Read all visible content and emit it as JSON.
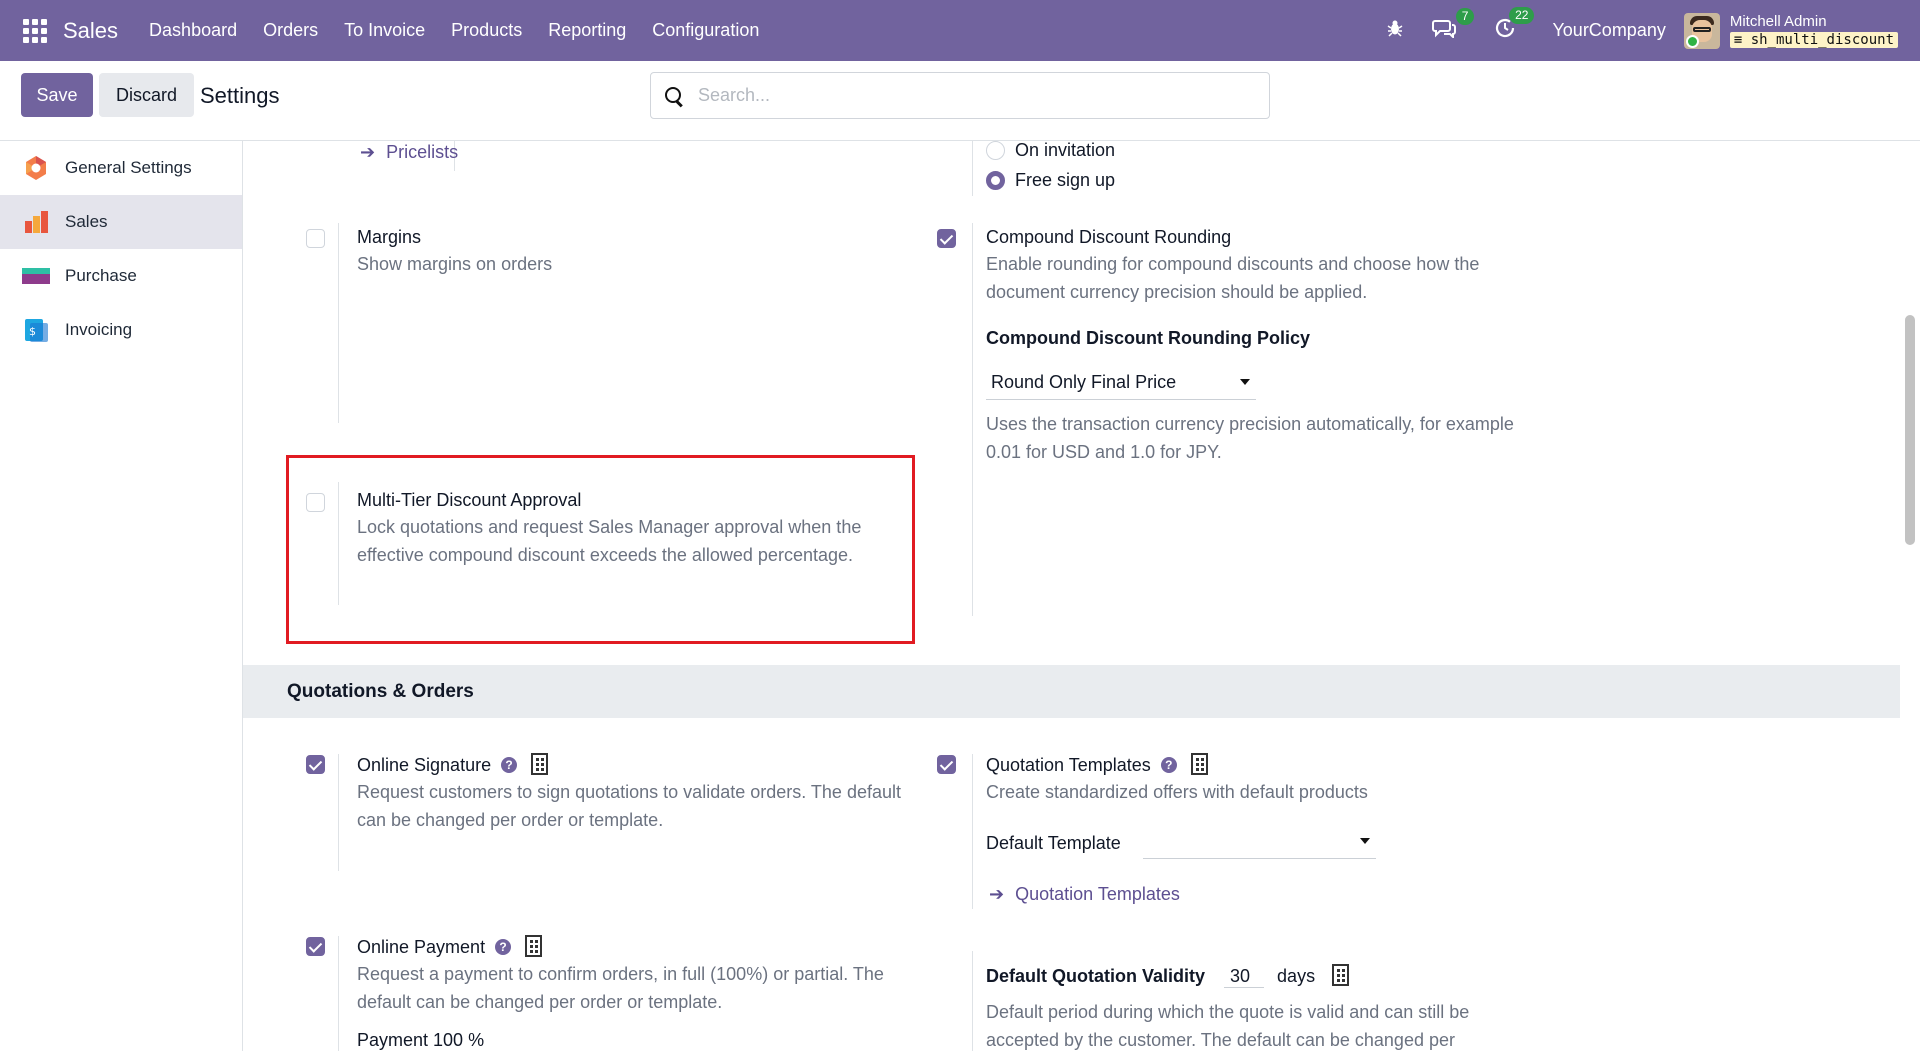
{
  "navbar": {
    "brand": "Sales",
    "menu": [
      "Dashboard",
      "Orders",
      "To Invoice",
      "Products",
      "Reporting",
      "Configuration"
    ],
    "messages_count": "7",
    "activities_count": "22",
    "company": "YourCompany",
    "user_name": "Mitchell Admin",
    "database": "sh_multi_discount",
    "nav_color": "#71639e"
  },
  "control": {
    "save_label": "Save",
    "discard_label": "Discard",
    "breadcrumb": "Settings",
    "search_placeholder": "Search..."
  },
  "sidebar": {
    "items": [
      {
        "label": "General Settings",
        "icon": "general-settings-icon",
        "active": false
      },
      {
        "label": "Sales",
        "icon": "sales-app-icon",
        "active": true
      },
      {
        "label": "Purchase",
        "icon": "purchase-app-icon",
        "active": false
      },
      {
        "label": "Invoicing",
        "icon": "invoicing-app-icon",
        "active": false
      }
    ]
  },
  "settings": {
    "pricelists_link": "Pricelists",
    "signup": {
      "option_invitation": "On invitation",
      "option_free": "Free sign up",
      "selected": "Free sign up"
    },
    "margins": {
      "title": "Margins",
      "desc": "Show margins on orders",
      "checked": false
    },
    "compound_rounding": {
      "title": "Compound Discount Rounding",
      "desc": "Enable rounding for compound discounts and choose how the document currency precision should be applied.",
      "checked": true,
      "policy_label": "Compound Discount Rounding Policy",
      "policy_value": "Round Only Final Price",
      "policy_desc": "Uses the transaction currency precision automatically, for example 0.01 for USD and 1.0 for JPY."
    },
    "multi_tier": {
      "title": "Multi-Tier Discount Approval",
      "desc": "Lock quotations and request Sales Manager approval when the effective compound discount exceeds the allowed percentage.",
      "checked": false
    },
    "section_title": "Quotations & Orders",
    "online_signature": {
      "title": "Online Signature",
      "desc": "Request customers to sign quotations to validate orders. The default can be changed per order or template.",
      "checked": true
    },
    "quotation_templates": {
      "title": "Quotation Templates",
      "desc": "Create standardized offers with default products",
      "checked": true,
      "default_label": "Default Template",
      "default_value": "",
      "link": "Quotation Templates"
    },
    "online_payment": {
      "title": "Online Payment",
      "desc": "Request a payment to confirm orders, in full (100%) or partial. The default can be changed per order or template.",
      "checked": true,
      "partial_text": "Payment 100 %"
    },
    "validity": {
      "label": "Default Quotation Validity",
      "value": "30",
      "unit": "days",
      "desc": "Default period during which the quote is valid and can still be accepted by the customer. The default can be changed per"
    }
  }
}
